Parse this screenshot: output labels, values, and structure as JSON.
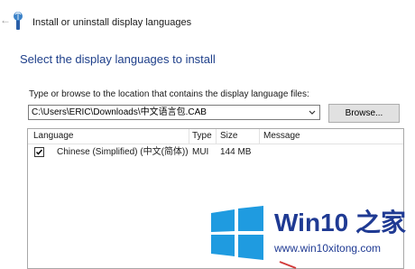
{
  "window": {
    "title": "Install or uninstall display languages",
    "back_symbol": "←"
  },
  "main": {
    "heading": "Select the display languages to install",
    "path_label": "Type or browse to the location that contains the display language files:",
    "path_value": "C:\\Users\\ERIC\\Downloads\\中文语言包.CAB",
    "browse_label": "Browse..."
  },
  "table": {
    "columns": [
      "Language",
      "Type",
      "Size",
      "Message"
    ],
    "rows": [
      {
        "checked": true,
        "language": "Chinese (Simplified) (中文(简体))",
        "type": "MUI",
        "size": "144 MB",
        "message": ""
      }
    ]
  },
  "watermark": {
    "brand": "Win10 之家",
    "url": "www.win10xitong.com",
    "logo_color": "#1f9be0",
    "text_color": "#1f3a93"
  },
  "icons": {
    "title_icon": "language-pack-icon",
    "combo_arrow": "chevron-down-icon",
    "check": "checkmark-icon"
  }
}
